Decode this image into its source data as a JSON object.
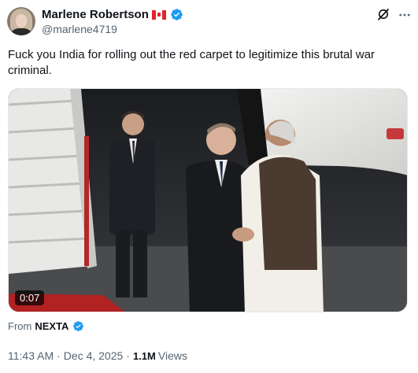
{
  "author": {
    "display_name": "Marlene Robertson",
    "handle": "@marlene4719",
    "flag": "canada-flag",
    "verified_color": "#1d9bf0"
  },
  "tweet": {
    "text": "Fuck you India for rolling out the red carpet to legitimize this brutal war criminal."
  },
  "video": {
    "duration": "0:07"
  },
  "source": {
    "prefix": "From",
    "name": "NEXTA"
  },
  "meta": {
    "time": "11:43 AM",
    "separator1": "·",
    "date": "Dec 4, 2025",
    "separator2": "·",
    "views_count": "1.1M",
    "views_label": "Views"
  },
  "icons": {
    "grok": "grok-icon",
    "more": "more-horizontal-icon",
    "verified": "verified-badge-icon"
  }
}
